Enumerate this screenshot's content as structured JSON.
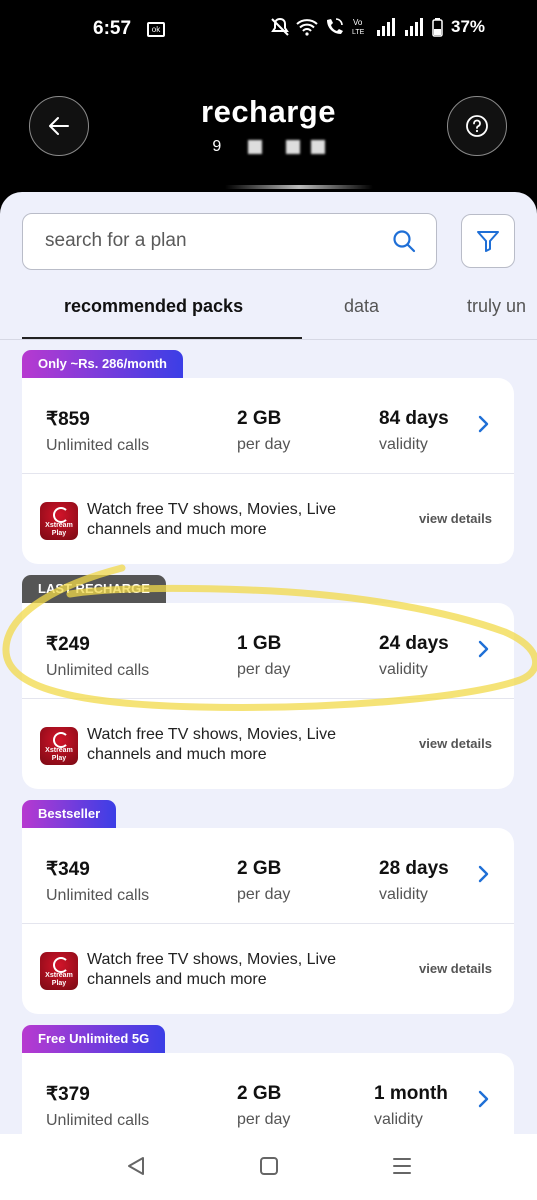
{
  "status_bar": {
    "time": "6:57",
    "left_icon": "ok",
    "battery": "37%",
    "icons": [
      "mute-icon",
      "wifi-icon",
      "wifi-calling-icon",
      "volte-icon",
      "signal-icon",
      "signal-icon",
      "battery-icon"
    ]
  },
  "header": {
    "title": "recharge",
    "subtitle": "9"
  },
  "search": {
    "placeholder": "search for a plan"
  },
  "tabs": [
    {
      "label": "recommended packs",
      "active": true
    },
    {
      "label": "data",
      "active": false
    },
    {
      "label": "truly un",
      "active": false
    }
  ],
  "plans": [
    {
      "tag": "Only ~Rs. 286/month",
      "price": "₹859",
      "price_sub": "Unlimited calls",
      "data": "2 GB",
      "data_sub": "per day",
      "validity": "84 days",
      "validity_sub": "validity",
      "logo_text": "Xstream Play",
      "benefit": "Watch free TV shows, Movies, Live channels and much more",
      "details_label": "view details"
    },
    {
      "tag": "LAST RECHARGE",
      "price": "₹249",
      "price_sub": "Unlimited calls",
      "data": "1 GB",
      "data_sub": "per day",
      "validity": "24 days",
      "validity_sub": "validity",
      "logo_text": "Xstream Play",
      "benefit": "Watch free TV shows, Movies, Live channels and much more",
      "details_label": "view details"
    },
    {
      "tag": "Bestseller",
      "price": "₹349",
      "price_sub": "Unlimited calls",
      "data": "2 GB",
      "data_sub": "per day",
      "validity": "28 days",
      "validity_sub": "validity",
      "logo_text": "Xstream Play",
      "benefit": "Watch free TV shows, Movies, Live channels and much more",
      "details_label": "view details"
    },
    {
      "tag": "Free Unlimited 5G",
      "price": "₹379",
      "price_sub": "Unlimited calls",
      "data": "2 GB",
      "data_sub": "per day",
      "validity": "1 month",
      "validity_sub": "validity"
    }
  ],
  "colors": {
    "accent": "#1f6fd6",
    "tag_gradient_start": "#b73ad0",
    "tag_gradient_end": "#3b3ee6",
    "last_recharge_tag": "#555555",
    "highlighter": "#f2d94a",
    "sheet_background": "#eef0fb"
  },
  "nav": [
    "back-nav-icon",
    "home-nav-icon",
    "recents-nav-icon"
  ]
}
